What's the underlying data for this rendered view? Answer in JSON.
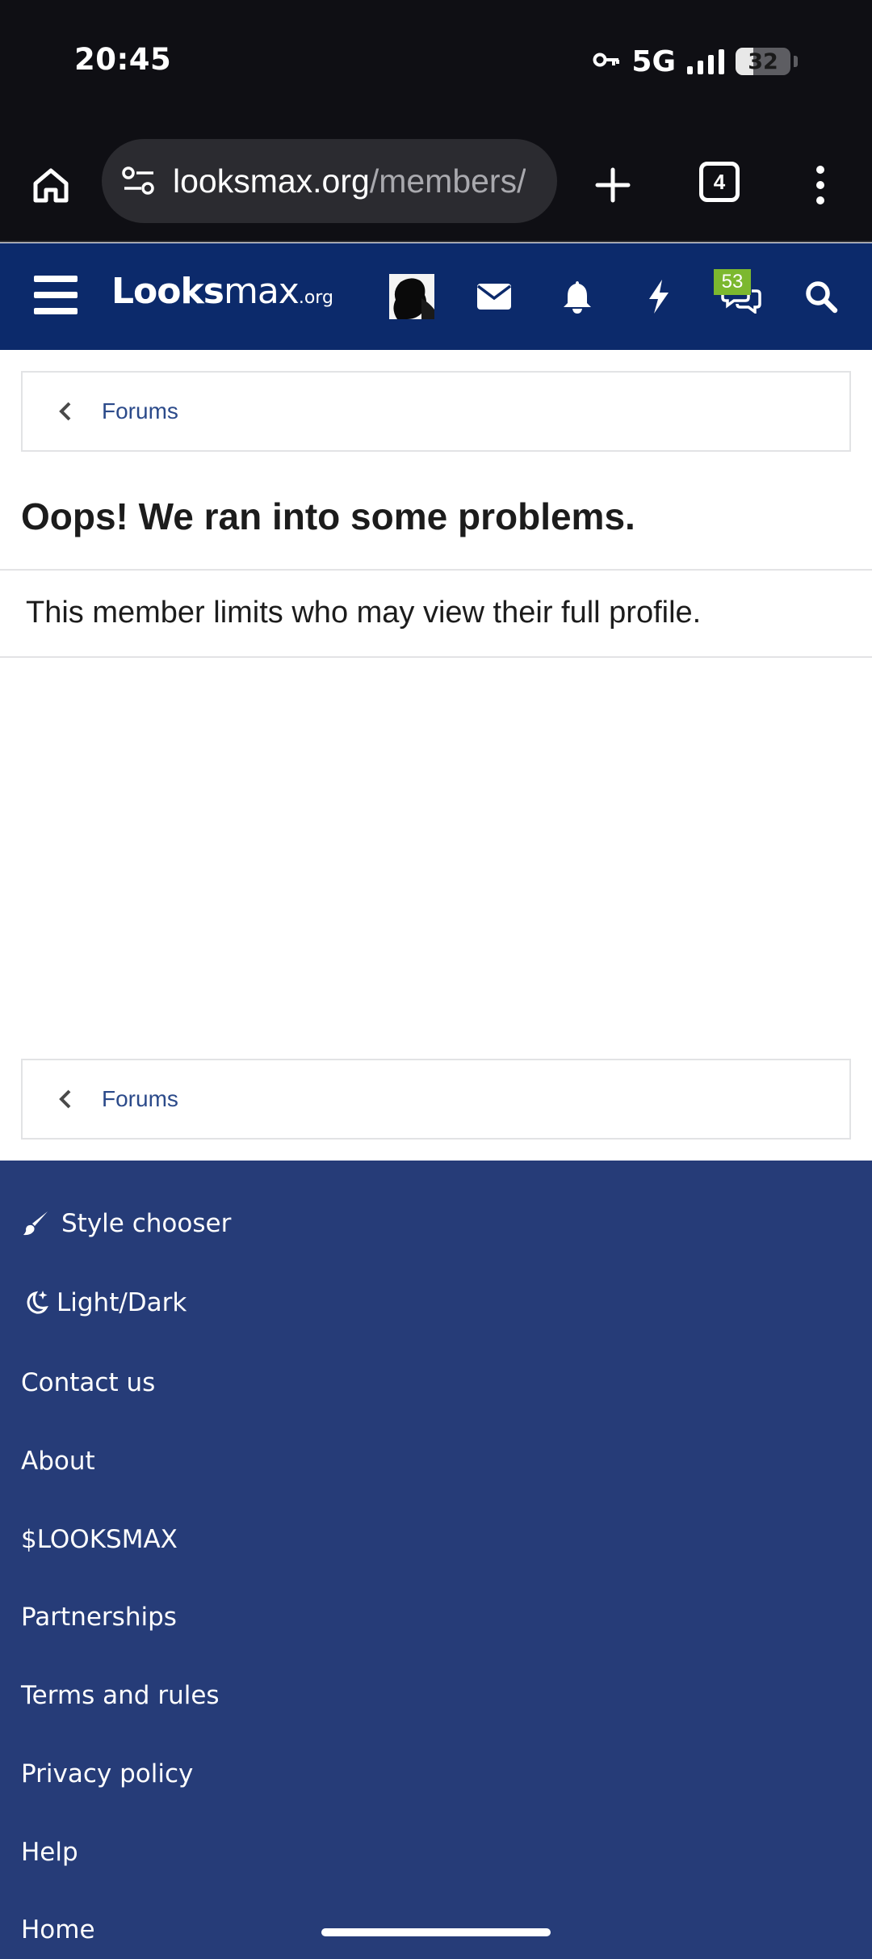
{
  "status_bar": {
    "time": "20:45",
    "network": "5G",
    "battery": "32",
    "battery_level": 0.32,
    "vpn_icon": "key-icon"
  },
  "browser": {
    "url_host": "looksmax.org",
    "url_path": "/members/",
    "tab_count": "4"
  },
  "site_header": {
    "logo_main": "Looks",
    "logo_max": "max",
    "logo_tld": ".org",
    "chat_badge": "53",
    "brand_color": "#0c2a6b",
    "badge_color": "#7cb82f"
  },
  "breadcrumb": {
    "label": "Forums"
  },
  "main": {
    "title": "Oops! We ran into some problems.",
    "message": "This member limits who may view their full profile."
  },
  "footer": {
    "background_color": "#263c78",
    "items": [
      {
        "label": "Style chooser",
        "icon": "paintbrush-icon"
      },
      {
        "label": "Light/Dark",
        "icon": "moon-icon"
      },
      {
        "label": "Contact us"
      },
      {
        "label": "About"
      },
      {
        "label": "$LOOKSMAX"
      },
      {
        "label": "Partnerships"
      },
      {
        "label": "Terms and rules"
      },
      {
        "label": "Privacy policy"
      },
      {
        "label": "Help"
      },
      {
        "label": "Home"
      }
    ]
  }
}
